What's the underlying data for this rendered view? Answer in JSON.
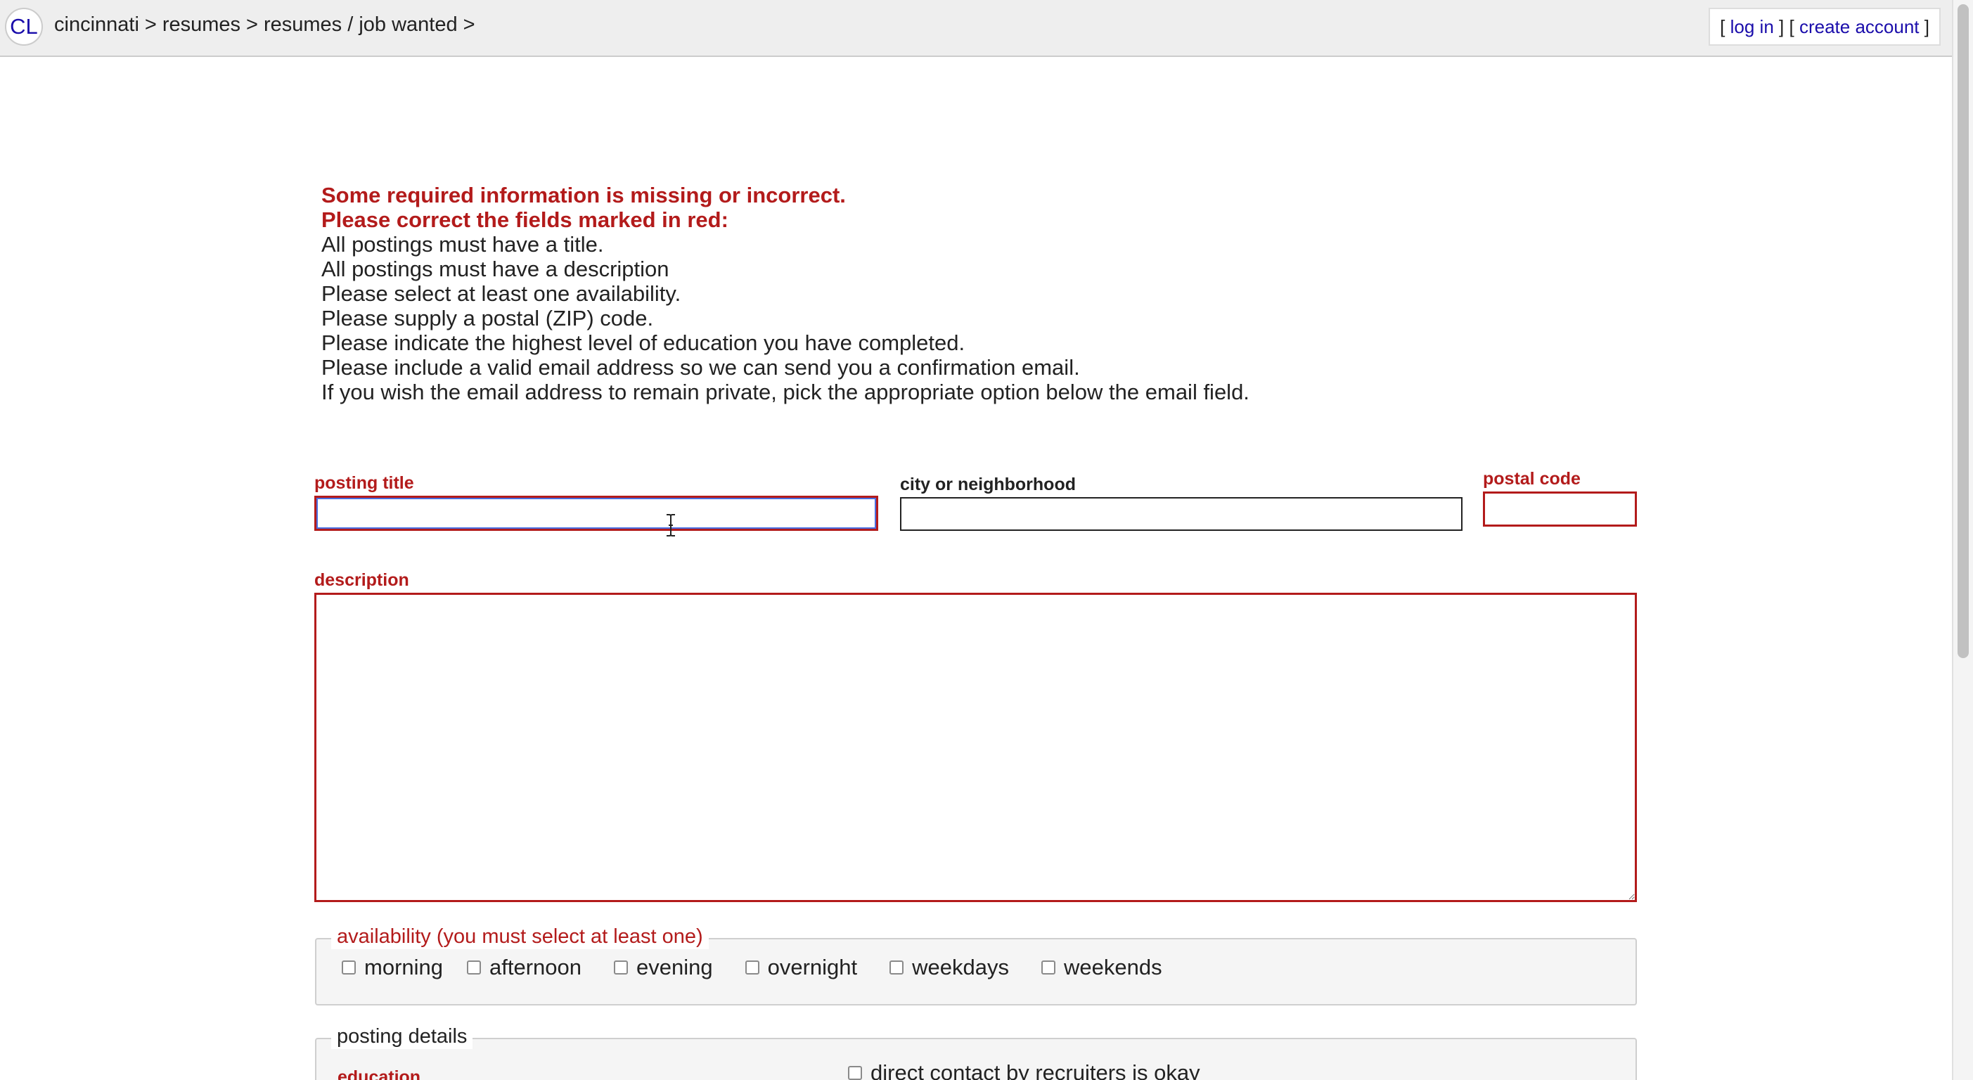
{
  "header": {
    "logo": "CL",
    "breadcrumb": [
      "cincinnati",
      "resumes",
      "resumes / job wanted"
    ],
    "separator": ">",
    "account": {
      "bracket_open": "[",
      "bracket_close": "]",
      "login_label": "log in",
      "create_label": "create account"
    }
  },
  "errors": {
    "heading_1": "Some required information is missing or incorrect.",
    "heading_2": "Please correct the fields marked in red:",
    "messages": [
      "All postings must have a title.",
      "All postings must have a description",
      "Please select at least one availability.",
      "Please supply a postal (ZIP) code.",
      "Please indicate the highest level of education you have completed.",
      "Please include a valid email address so we can send you a confirmation email.",
      "If you wish the email address to remain private, pick the appropriate option below the email field."
    ]
  },
  "form": {
    "posting_title": {
      "label": "posting title",
      "value": "",
      "error": true
    },
    "city": {
      "label": "city or neighborhood",
      "value": "",
      "error": false
    },
    "postal_code": {
      "label": "postal code",
      "value": "",
      "error": true
    },
    "description": {
      "label": "description",
      "value": "",
      "error": true
    },
    "availability": {
      "legend": "availability (you must select at least one)",
      "options": [
        "morning",
        "afternoon",
        "evening",
        "overnight",
        "weekdays",
        "weekends"
      ]
    },
    "posting_details": {
      "legend": "posting details",
      "education_label": "education",
      "recruiters_label": "direct contact by recruiters is okay"
    }
  },
  "colors": {
    "error_red": "#b31b1b",
    "link_blue": "#1a0dab",
    "focus_blue": "#4a6ee0",
    "header_bg": "#eeeeee"
  }
}
